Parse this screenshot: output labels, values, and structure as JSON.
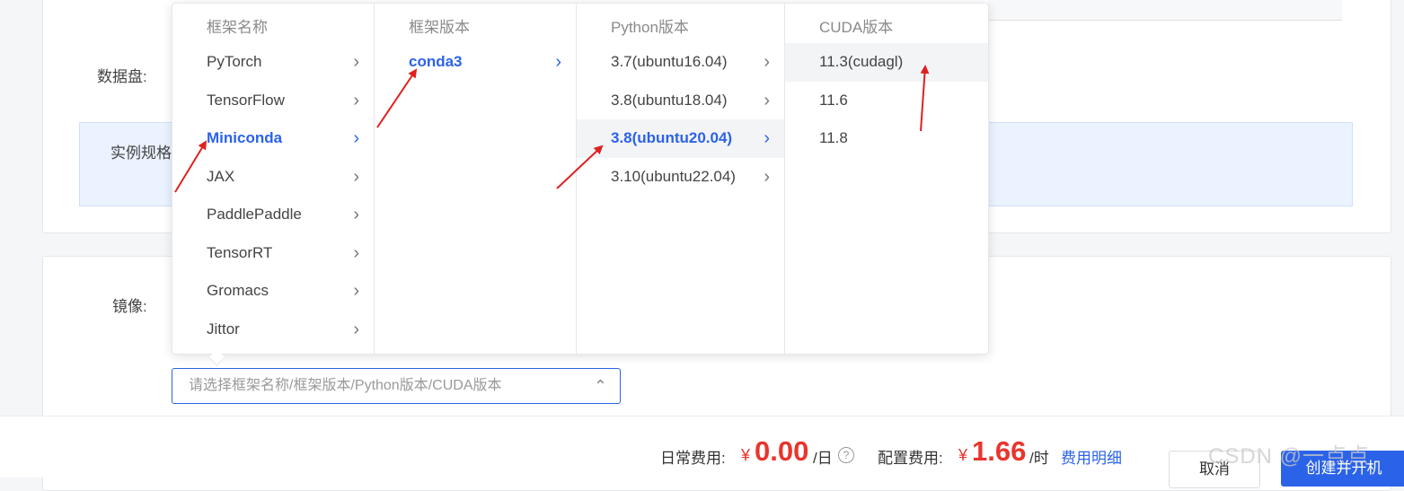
{
  "form": {
    "data_disk_label": "数据盘:",
    "instance_spec_label": "实例规格",
    "image_label": "镜像:"
  },
  "cascader": {
    "columns": [
      {
        "header": "框架名称",
        "options": [
          "PyTorch",
          "TensorFlow",
          "Miniconda",
          "JAX",
          "PaddlePaddle",
          "TensorRT",
          "Gromacs",
          "Jittor"
        ],
        "active": "Miniconda"
      },
      {
        "header": "框架版本",
        "options": [
          "conda3"
        ],
        "active": "conda3"
      },
      {
        "header": "Python版本",
        "options": [
          "3.7(ubuntu16.04)",
          "3.8(ubuntu18.04)",
          "3.8(ubuntu20.04)",
          "3.10(ubuntu22.04)"
        ],
        "active": "3.8(ubuntu20.04)"
      },
      {
        "header": "CUDA版本",
        "options": [
          "11.3(cudagl)",
          "11.6",
          "11.8"
        ],
        "hovered": "11.3(cudagl)"
      }
    ],
    "chevron": "›"
  },
  "image_select": {
    "placeholder": "请选择框架名称/框架版本/Python版本/CUDA版本",
    "caret": "⌃"
  },
  "footer": {
    "daily_fee_label": "日常费用:",
    "daily_fee_currency": "¥",
    "daily_fee_amount": "0.00",
    "daily_fee_unit": "/日",
    "help_symbol": "?",
    "config_fee_label": "配置费用:",
    "config_fee_currency": "¥",
    "config_fee_amount": "1.66",
    "config_fee_unit": "/时",
    "fee_detail_link": "费用明细",
    "cancel_button": "取消",
    "create_button": "创建并开机"
  },
  "watermark": "CSDN @一点点",
  "colors": {
    "accent": "#2b63e8",
    "price_red": "#e8352d",
    "annotation_arrow": "#e02020"
  }
}
